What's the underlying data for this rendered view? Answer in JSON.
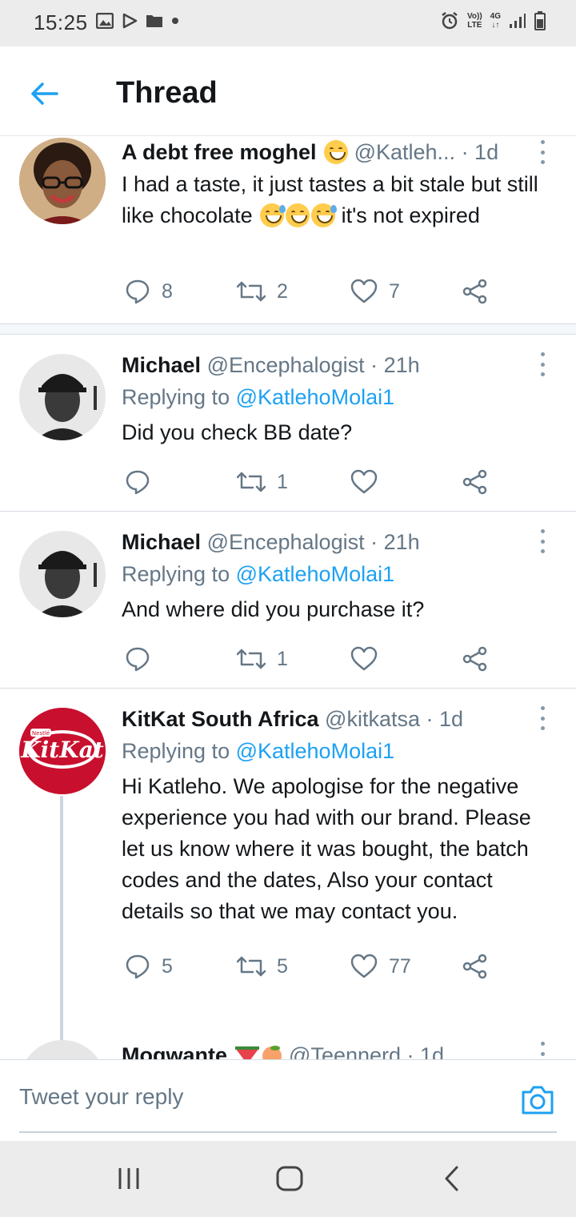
{
  "status_bar": {
    "time": "15:25",
    "network_top": "Vo))",
    "network_bottom": "LTE",
    "generation_top": "4G",
    "generation_bottom": "↓↑"
  },
  "header": {
    "title": "Thread"
  },
  "tweets": [
    {
      "name": "A debt free moghel",
      "handle": "@Katleh...",
      "time": "· 1d",
      "replying_prefix": "",
      "replying_handle": "",
      "body_before": "I had a taste, it just tastes a bit stale but still like chocolate",
      "body_after": " it's not expired",
      "replies": "8",
      "retweets": "2",
      "likes": "7"
    },
    {
      "name": "Michael",
      "handle": "@Encephalogist",
      "time": "· 21h",
      "replying_prefix": "Replying to ",
      "replying_handle": "@KatlehoMolai1",
      "body": "Did you check BB date?",
      "replies": "",
      "retweets": "1",
      "likes": ""
    },
    {
      "name": "Michael",
      "handle": "@Encephalogist",
      "time": "· 21h",
      "replying_prefix": "Replying to ",
      "replying_handle": "@KatlehoMolai1",
      "body": "And where did you purchase it?",
      "replies": "",
      "retweets": "1",
      "likes": ""
    },
    {
      "name": "KitKat South Africa",
      "handle": "@kitkatsa",
      "time": "· 1d",
      "replying_prefix": "Replying to ",
      "replying_handle": "@KatlehoMolai1",
      "body": "Hi Katleho. We apologise for the negative experience you had with our brand. Please let us know where it was bought, the batch codes and the dates, Also your contact details so that we may contact you.",
      "replies": "5",
      "retweets": "5",
      "likes": "77"
    },
    {
      "name": "Mogwante",
      "handle": "@Teennerd",
      "time": "· 1d"
    }
  ],
  "avatar_kitkat": {
    "brand": "KitKat",
    "badge": "Nestlé"
  },
  "composer": {
    "placeholder": "Tweet your reply"
  },
  "colors": {
    "accent": "#1da1f2",
    "kitkat_red": "#c8102e",
    "secondary_text": "#657786"
  }
}
